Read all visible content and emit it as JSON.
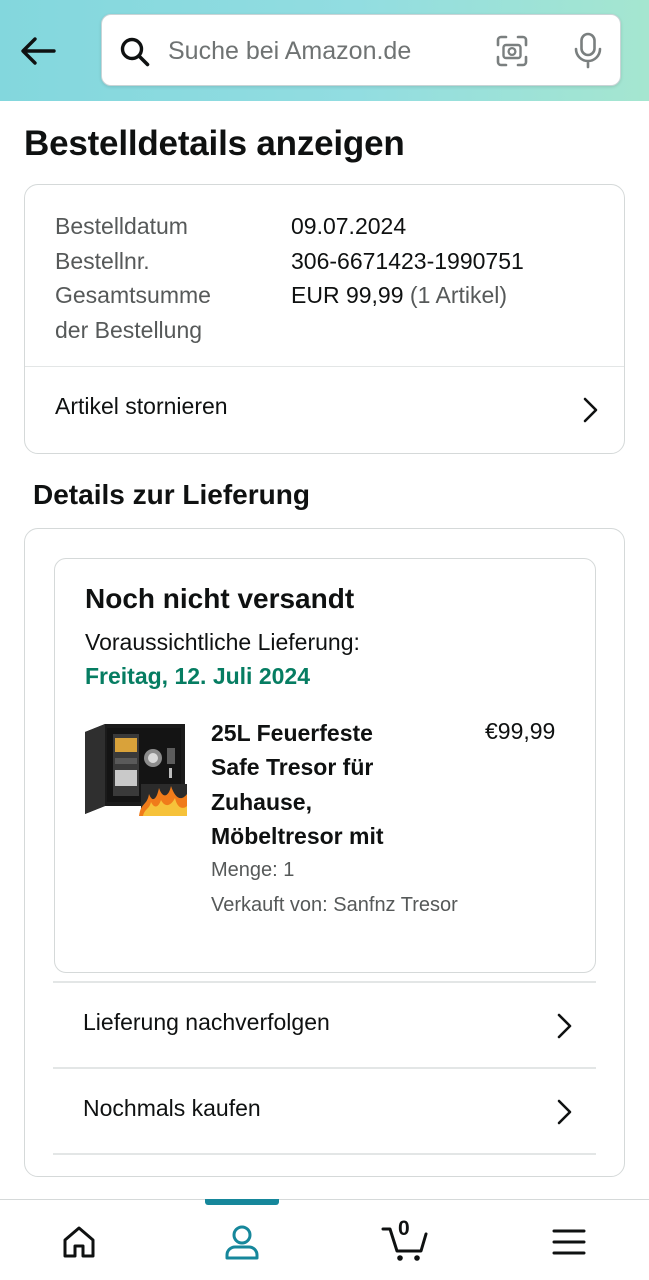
{
  "header": {
    "back_icon": "arrow-left-icon",
    "search_placeholder": "Suche bei Amazon.de",
    "search_icon": "search-icon",
    "camera_icon": "camera-scan-icon",
    "mic_icon": "microphone-icon"
  },
  "page_title": "Bestelldetails anzeigen",
  "order": {
    "rows": [
      {
        "label": "Bestelldatum",
        "value": "09.07.2024",
        "extra": ""
      },
      {
        "label": "Bestellnr.",
        "value": "306-6671423-1990751",
        "extra": ""
      },
      {
        "label": "Gesamtsumme",
        "value": "EUR 99,99",
        "extra": " (1 Artikel)"
      },
      {
        "label": "der Bestellung",
        "value": "",
        "extra": ""
      }
    ],
    "cancel_label": "Artikel stornieren"
  },
  "delivery": {
    "section_title": "Details zur Lieferung",
    "status": "Noch nicht versandt",
    "eta_label": "Voraussichtliche Lieferung:",
    "eta_date": "Freitag, 12. Juli 2024",
    "product": {
      "title_lines": [
        "25L Feuerfeste",
        "Safe Tresor für",
        "Zuhause,",
        "Möbeltresor mit"
      ],
      "price": "€99,99",
      "quantity": "Menge: 1",
      "seller": "Verkauft von: Sanfnz Tresor"
    },
    "track_label": "Lieferung nachverfolgen",
    "rebuy_label": "Nochmals kaufen"
  },
  "bottom_nav": {
    "items": [
      "home-icon",
      "account-icon",
      "cart-icon",
      "menu-icon"
    ],
    "cart_count": "0",
    "active": "account-icon",
    "accent_color": "#16879b"
  },
  "colors": {
    "green": "#067d62",
    "muted_text": "#565959"
  }
}
